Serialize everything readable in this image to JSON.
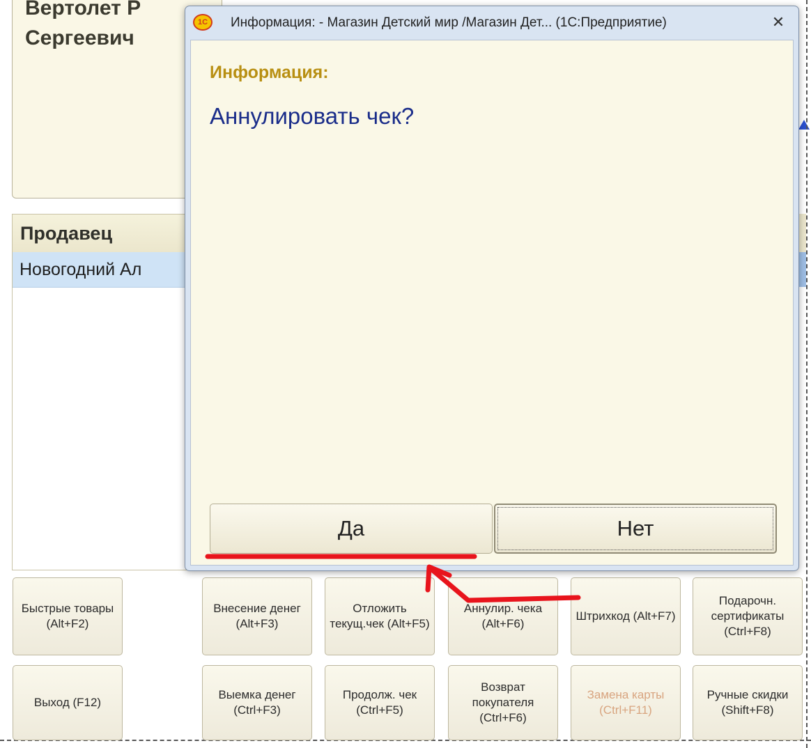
{
  "background": {
    "customer_name": "Вертолет Р Сергеевич",
    "seller_header": "Продавец",
    "seller_row": "Новогодний Ал"
  },
  "dialog": {
    "title": "Информация: - Магазин Детский мир /Магазин Дет...  (1С:Предприятие)",
    "app_icon": "1С",
    "close_glyph": "✕",
    "heading": "Информация:",
    "question": "Аннулировать чек?",
    "yes_label": "Да",
    "no_label": "Нет"
  },
  "buttons": {
    "row1": {
      "quick_goods": "Быстрые товары (Alt+F2)",
      "cash_in": "Внесение денег (Alt+F3)",
      "postpone": "Отложить текущ.чек (Alt+F5)",
      "annul": "Аннулир. чека (Alt+F6)",
      "barcode": "Штрихкод (Alt+F7)",
      "gift_cert": "Подарочн. сертификаты (Ctrl+F8)"
    },
    "row2": {
      "exit": "Выход (F12)",
      "cash_out": "Выемка денег (Ctrl+F3)",
      "continue": "Продолж. чек (Ctrl+F5)",
      "return": "Возврат покупателя (Ctrl+F6)",
      "replace_card": "Замена карты (Ctrl+F11)",
      "manual_discount": "Ручные скидки (Shift+F8)"
    }
  },
  "colors": {
    "dialog_heading": "#b88f12",
    "dialog_question": "#1a2d8a",
    "annotation": "#e8141c",
    "disabled_text": "#d8a47f"
  }
}
